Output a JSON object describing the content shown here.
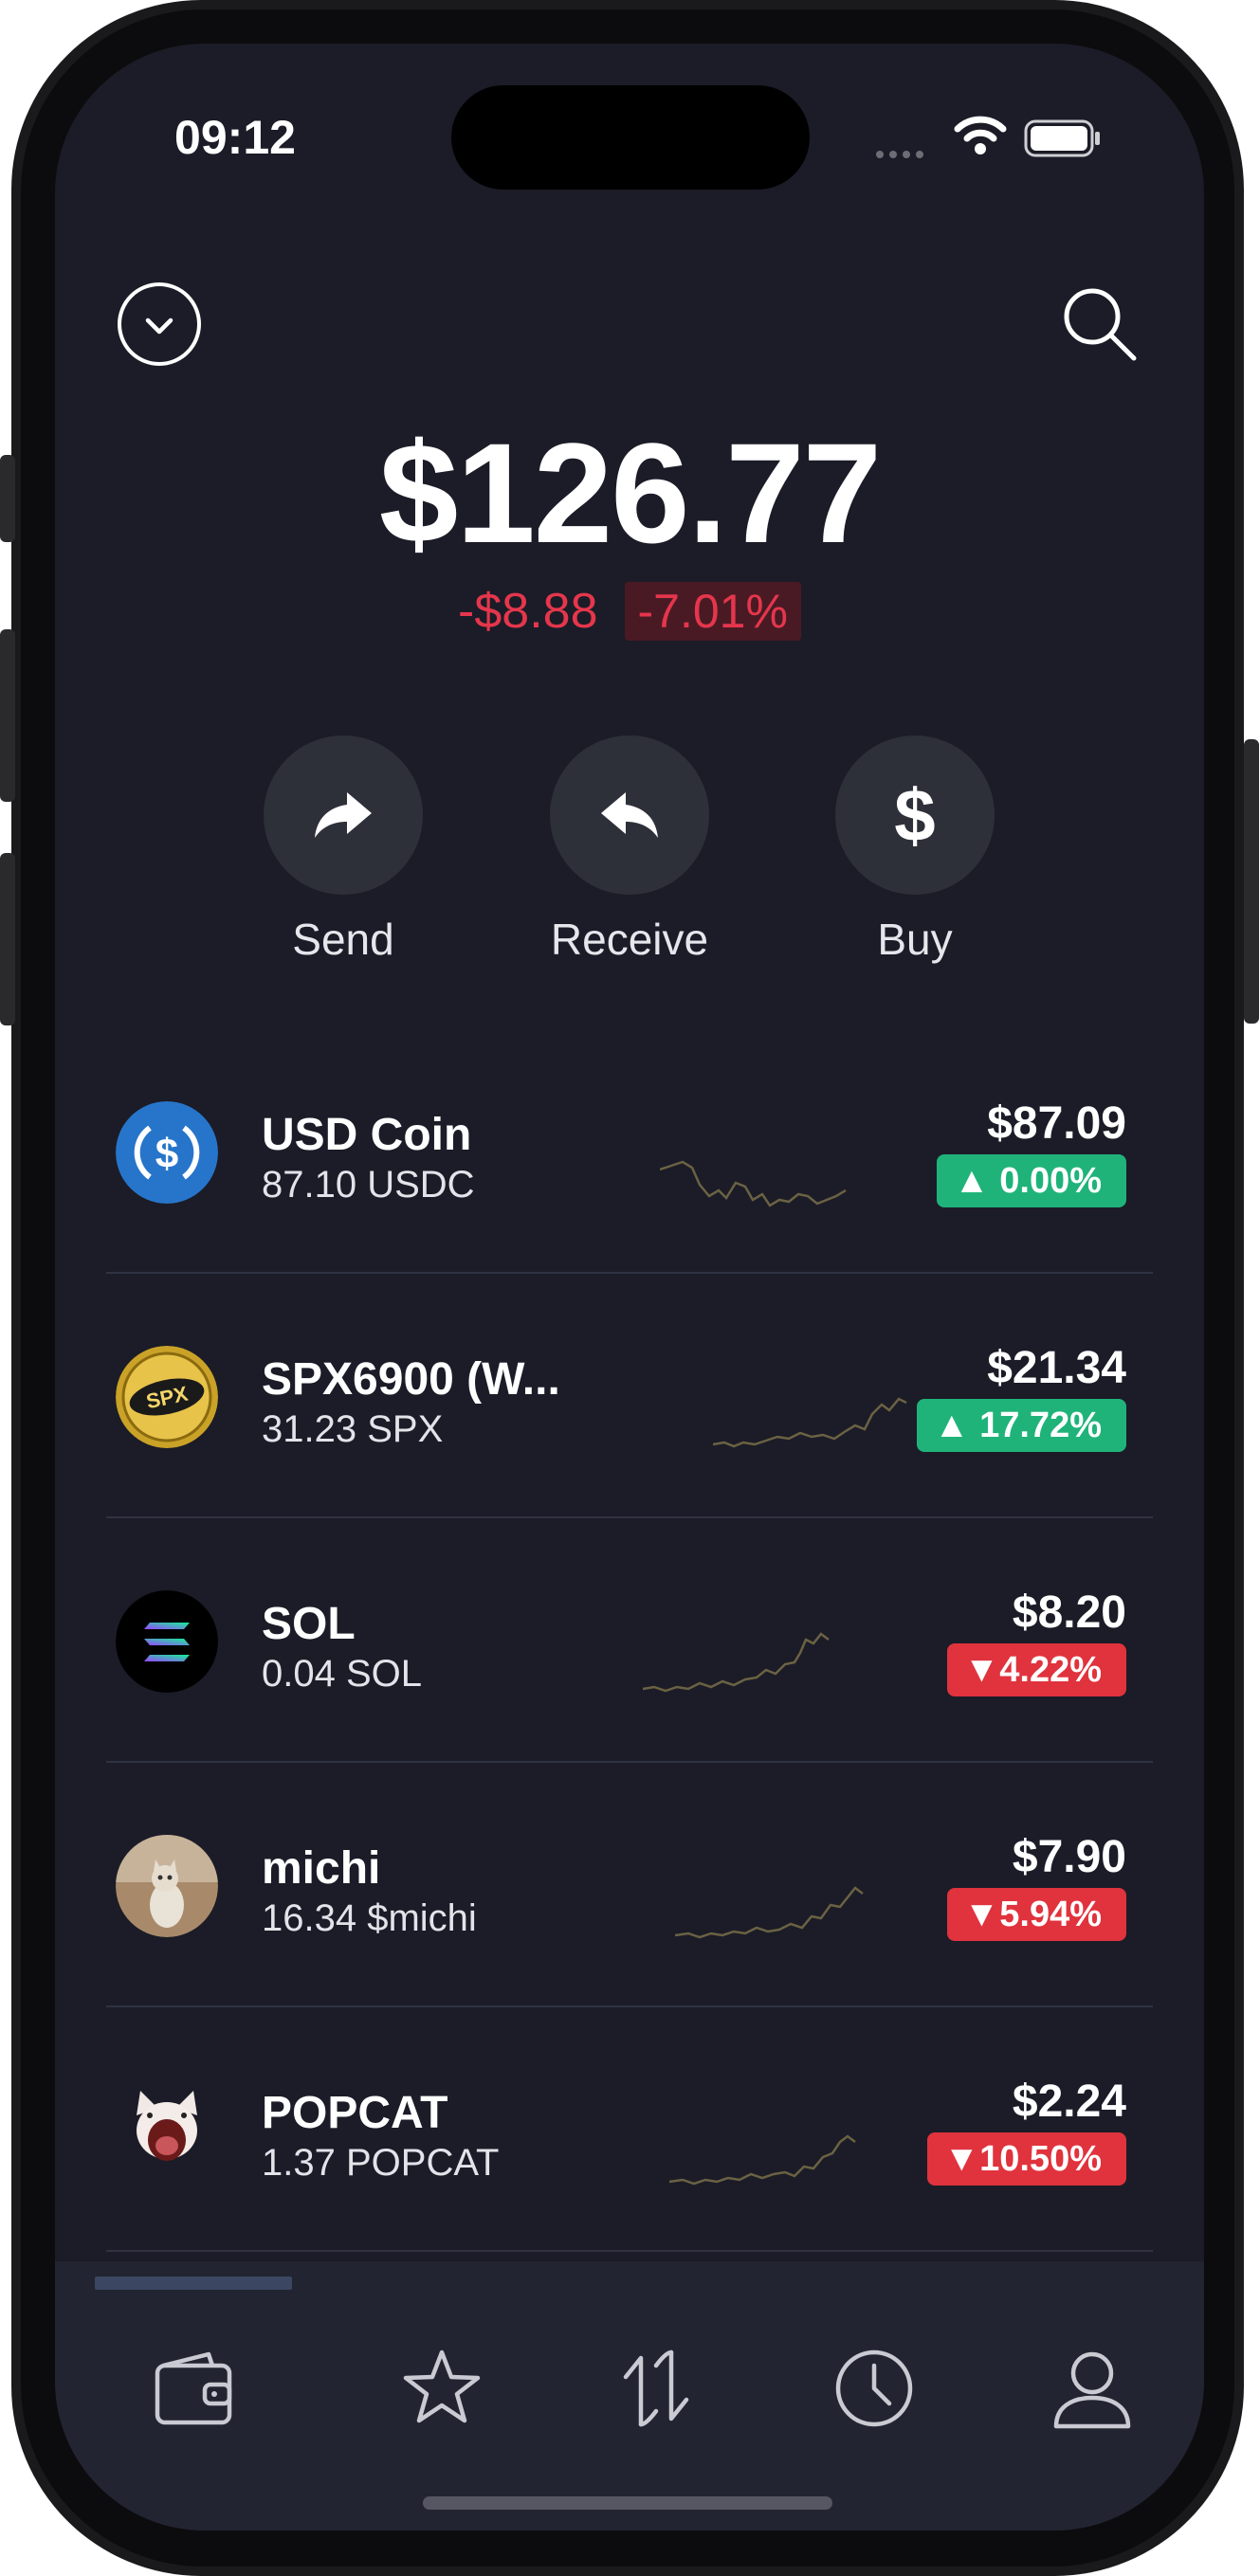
{
  "status_bar": {
    "time": "09:12"
  },
  "header": {
    "menu_icon": "chevron-down-circle-icon",
    "search_icon": "search-icon"
  },
  "balance": {
    "total": "$126.77",
    "change_abs": "-$8.88",
    "change_pct": "-7.01%"
  },
  "actions": [
    {
      "label": "Send",
      "icon": "send-arrow-icon"
    },
    {
      "label": "Receive",
      "icon": "receive-arrow-icon"
    },
    {
      "label": "Buy",
      "icon": "dollar-icon"
    }
  ],
  "tokens": [
    {
      "name": "USD Coin",
      "amount": "87.10 USDC",
      "value": "$87.09",
      "change": "▲ 0.00%",
      "direction": "up",
      "icon": "usdc-logo-icon"
    },
    {
      "name": "SPX6900 (W...",
      "amount": "31.23 SPX",
      "value": "$21.34",
      "change": "▲ 17.72%",
      "direction": "up",
      "icon": "spx6900-logo-icon"
    },
    {
      "name": "SOL",
      "amount": "0.04 SOL",
      "value": "$8.20",
      "change": "▼4.22%",
      "direction": "down",
      "icon": "solana-logo-icon"
    },
    {
      "name": "michi",
      "amount": "16.34 $michi",
      "value": "$7.90",
      "change": "▼5.94%",
      "direction": "down",
      "icon": "michi-cat-icon"
    },
    {
      "name": "POPCAT",
      "amount": "1.37 POPCAT",
      "value": "$2.24",
      "change": "▼10.50%",
      "direction": "down",
      "icon": "popcat-icon"
    }
  ],
  "bottom_nav": [
    {
      "icon": "wallet-icon",
      "active": true
    },
    {
      "icon": "star-icon",
      "active": false
    },
    {
      "icon": "swap-arrows-icon",
      "active": false
    },
    {
      "icon": "clock-icon",
      "active": false
    },
    {
      "icon": "user-icon",
      "active": false
    }
  ],
  "colors": {
    "background": "#1b1c27",
    "positive": "#1fb37a",
    "negative": "#e0333d",
    "sparkline": "#6b6244"
  }
}
